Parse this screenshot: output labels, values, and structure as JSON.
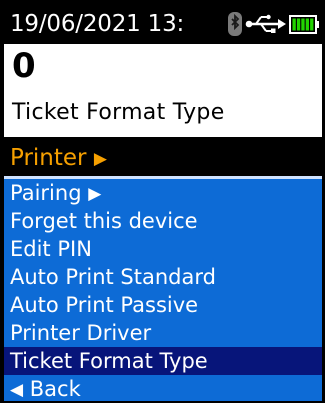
{
  "status_bar": {
    "datetime": "19/06/2021 13:",
    "icons": [
      "bluetooth-icon",
      "usb-icon",
      "battery-icon"
    ],
    "battery_level": 1.0,
    "battery_color": "#22d400"
  },
  "value_display": {
    "value": "0",
    "label": "Ticket Format Type"
  },
  "menu": {
    "header": "Printer",
    "header_arrow": "▶",
    "header_color": "#f6a000",
    "items": [
      {
        "label": "Pairing",
        "arrow_after": "▶"
      },
      {
        "label": "Forget this device"
      },
      {
        "label": "Edit PIN"
      },
      {
        "label": "Auto Print Standard"
      },
      {
        "label": "Auto Print Passive"
      },
      {
        "label": "Printer Driver"
      },
      {
        "label": "Ticket Format Type",
        "selected": true
      },
      {
        "label": "Back",
        "arrow_before": "◀"
      }
    ],
    "list_color": "#0d6bd6",
    "selected_color": "#07157a"
  }
}
